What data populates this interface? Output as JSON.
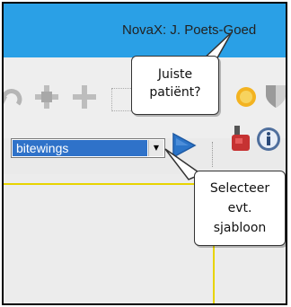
{
  "window": {
    "title": "NovaX: J. Poets-Goed"
  },
  "toolbar": {
    "template_select": {
      "selected": "bitewings"
    }
  },
  "callouts": [
    {
      "text": "Juiste\npatiënt?"
    },
    {
      "text": "Selecteer\nevt.\nsjabloon"
    }
  ],
  "colors": {
    "titlebar": "#2aa0e6",
    "selection": "#2f72c9",
    "accent_yellow": "#e8d400",
    "play_blue": "#2b74c8"
  },
  "icons": [
    "undo-icon",
    "crosshair-icon",
    "cross-icon",
    "sun-icon",
    "shield-icon",
    "play-icon",
    "tools-icon",
    "info-icon"
  ]
}
